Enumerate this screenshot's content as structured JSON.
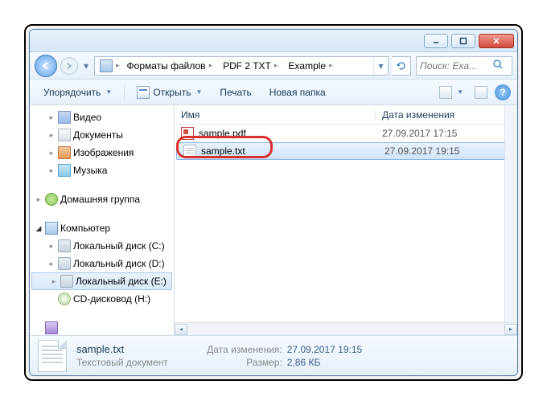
{
  "titlebar": {
    "min": "_",
    "max": "□",
    "close": "×"
  },
  "breadcrumb": {
    "computer": "",
    "formats": "Форматы файлов",
    "pdf2txt": "PDF 2 TXT",
    "example": "Example"
  },
  "search": {
    "placeholder": "Поиск: Exa..."
  },
  "toolbar": {
    "organize": "Упорядочить",
    "open": "Открыть",
    "print": "Печать",
    "newfolder": "Новая папка"
  },
  "tree": {
    "video": "Видео",
    "documents": "Документы",
    "images": "Изображения",
    "music": "Музыка",
    "homegroup": "Домашняя группа",
    "computer": "Компьютер",
    "diskC": "Локальный диск (C:)",
    "diskD": "Локальный диск (D:)",
    "diskE": "Локальный диск (E:)",
    "cdH": "CD-дисковод (H:)"
  },
  "columns": {
    "name": "Имя",
    "date": "Дата изменения"
  },
  "files": [
    {
      "name": "sample.pdf",
      "date": "27.09.2017 17:15",
      "icon": "pdf",
      "selected": false
    },
    {
      "name": "sample.txt",
      "date": "27.09.2017 19:15",
      "icon": "txt",
      "selected": true
    }
  ],
  "status": {
    "filename": "sample.txt",
    "filetype": "Текстовый документ",
    "date_label": "Дата изменения:",
    "date_value": "27.09.2017 19:15",
    "size_label": "Размер:",
    "size_value": "2,86 КБ"
  }
}
